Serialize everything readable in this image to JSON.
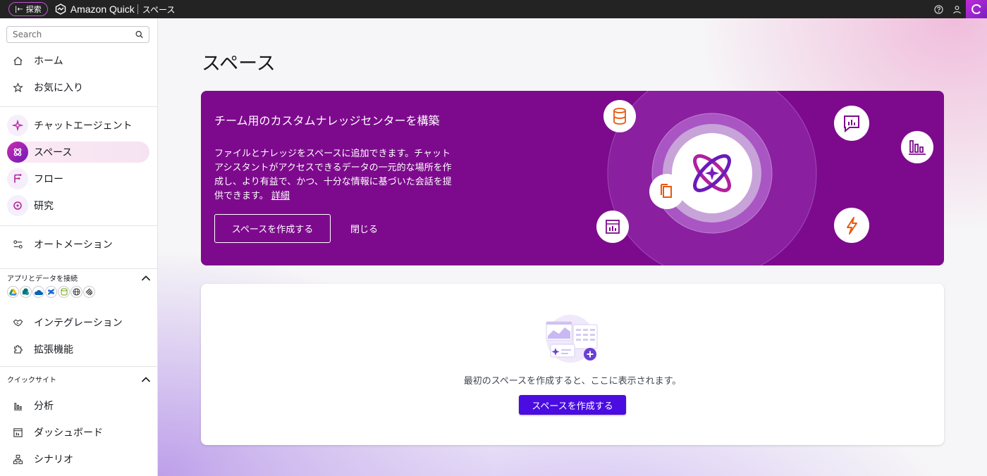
{
  "topbar": {
    "explore_label": "探索",
    "brand": "Amazon Quick",
    "breadcrumb": "スペース"
  },
  "sidebar": {
    "search_placeholder": "Search",
    "items": [
      {
        "label": "ホーム"
      },
      {
        "label": "お気に入り"
      },
      {
        "label": "チャットエージェント"
      },
      {
        "label": "スペース"
      },
      {
        "label": "フロー"
      },
      {
        "label": "研究"
      },
      {
        "label": "オートメーション"
      },
      {
        "label": "インテグレーション"
      },
      {
        "label": "拡張機能"
      },
      {
        "label": "分析"
      },
      {
        "label": "ダッシュボード"
      },
      {
        "label": "シナリオ"
      }
    ],
    "sections": {
      "apps": "アプリとデータを接続",
      "quicksight": "クイックサイト"
    }
  },
  "main": {
    "title": "スペース",
    "banner": {
      "title": "チーム用のカスタムナレッジセンターを構築",
      "description": "ファイルとナレッジをスペースに追加できます。チャットアシスタントがアクセスできるデータの一元的な場所を作成し、より有益で、かつ、十分な情報に基づいた会話を提供できます。",
      "link": "詳細",
      "create_label": "スペースを作成する",
      "close_label": "閉じる"
    },
    "empty": {
      "message": "最初のスペースを作成すると、ここに表示されます。",
      "create_label": "スペースを作成する"
    }
  },
  "colors": {
    "banner_bg": "#7d0a8d",
    "primary_button": "#4a0ce0",
    "accent": "#c02bd6"
  }
}
